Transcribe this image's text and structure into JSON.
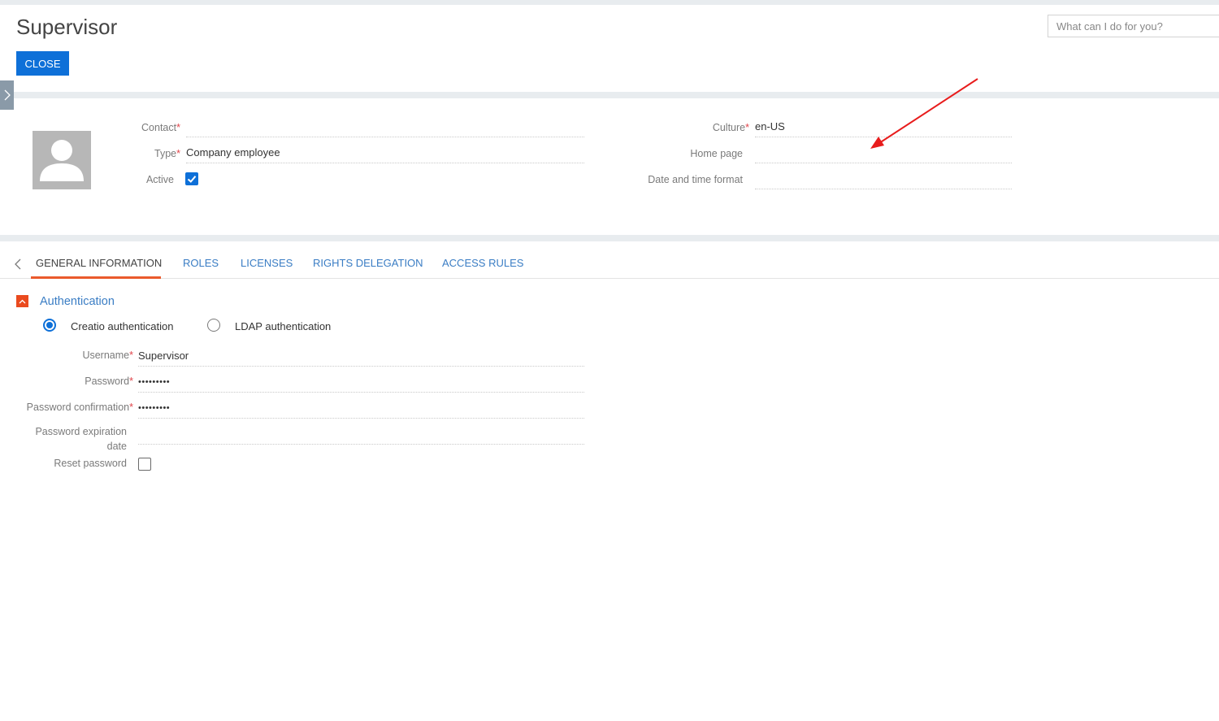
{
  "page": {
    "title": "Supervisor",
    "close_label": "CLOSE",
    "search_placeholder": "What can I do for you?"
  },
  "profile": {
    "left_fields": [
      {
        "label": "Contact",
        "required": true,
        "value": ""
      },
      {
        "label": "Type",
        "required": true,
        "value": "Company employee"
      },
      {
        "label": "Active",
        "required": false,
        "checked": true
      }
    ],
    "right_fields": [
      {
        "label": "Culture",
        "required": true,
        "value": "en-US"
      },
      {
        "label": "Home page",
        "required": false,
        "value": ""
      },
      {
        "label": "Date and time format",
        "required": false,
        "value": ""
      }
    ]
  },
  "tabs": [
    {
      "label": "GENERAL INFORMATION",
      "active": true
    },
    {
      "label": "ROLES",
      "active": false
    },
    {
      "label": "LICENSES",
      "active": false
    },
    {
      "label": "RIGHTS DELEGATION",
      "active": false
    },
    {
      "label": "ACCESS RULES",
      "active": false
    }
  ],
  "authentication": {
    "section_title": "Authentication",
    "options": [
      {
        "label": "Creatio authentication",
        "selected": true
      },
      {
        "label": "LDAP authentication",
        "selected": false
      }
    ],
    "fields": [
      {
        "label": "Username",
        "required": true,
        "value": "Supervisor"
      },
      {
        "label": "Password",
        "required": true,
        "value": "•••••••••"
      },
      {
        "label": "Password confirmation",
        "required": true,
        "value": "•••••••••"
      },
      {
        "label_line1": "Password expiration",
        "label_line2": "date",
        "required": false,
        "value": ""
      },
      {
        "label": "Reset password",
        "required": false,
        "checked": false
      }
    ]
  },
  "colors": {
    "accent_blue": "#0e70d8",
    "link_blue": "#3a7dc4",
    "tab_underline": "#ea5a2c",
    "required_star": "#e0454b",
    "annotation_arrow": "#e81c1c"
  },
  "icons": [
    "chevron-right-icon",
    "user-avatar-icon",
    "checkmark-icon",
    "chevron-left-icon",
    "chevron-up-icon"
  ]
}
